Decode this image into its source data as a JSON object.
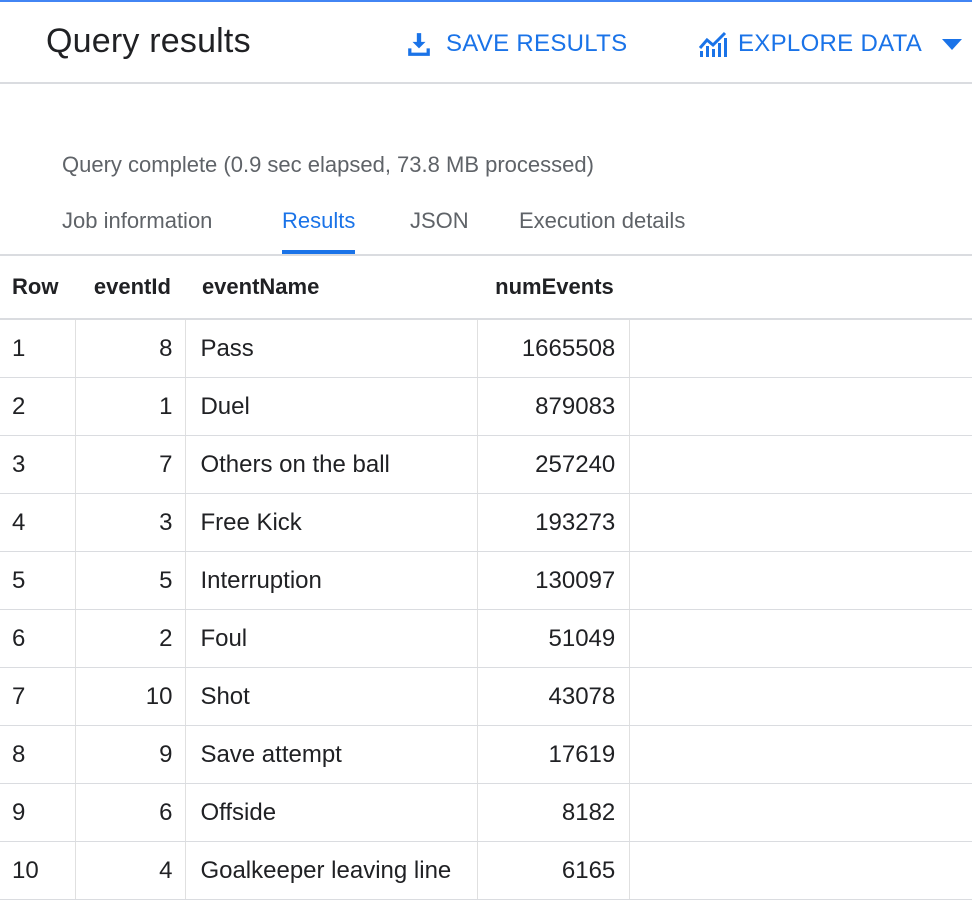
{
  "header": {
    "title": "Query results",
    "save_label": "SAVE RESULTS",
    "explore_label": "EXPLORE DATA",
    "accent": "#1a73e8"
  },
  "status": "Query complete (0.9 sec elapsed, 73.8 MB processed)",
  "tabs": [
    {
      "label": "Job information",
      "active": false
    },
    {
      "label": "Results",
      "active": true
    },
    {
      "label": "JSON",
      "active": false
    },
    {
      "label": "Execution details",
      "active": false
    }
  ],
  "table": {
    "columns": [
      "Row",
      "eventId",
      "eventName",
      "numEvents"
    ],
    "rows": [
      {
        "row": "1",
        "eventId": "8",
        "eventName": "Pass",
        "numEvents": "1665508"
      },
      {
        "row": "2",
        "eventId": "1",
        "eventName": "Duel",
        "numEvents": "879083"
      },
      {
        "row": "3",
        "eventId": "7",
        "eventName": "Others on the ball",
        "numEvents": "257240"
      },
      {
        "row": "4",
        "eventId": "3",
        "eventName": "Free Kick",
        "numEvents": "193273"
      },
      {
        "row": "5",
        "eventId": "5",
        "eventName": "Interruption",
        "numEvents": "130097"
      },
      {
        "row": "6",
        "eventId": "2",
        "eventName": "Foul",
        "numEvents": "51049"
      },
      {
        "row": "7",
        "eventId": "10",
        "eventName": "Shot",
        "numEvents": "43078"
      },
      {
        "row": "8",
        "eventId": "9",
        "eventName": "Save attempt",
        "numEvents": "17619"
      },
      {
        "row": "9",
        "eventId": "6",
        "eventName": "Offside",
        "numEvents": "8182"
      },
      {
        "row": "10",
        "eventId": "4",
        "eventName": "Goalkeeper leaving line",
        "numEvents": "6165"
      }
    ]
  },
  "icons": {
    "save": "download-icon",
    "explore": "chart-line-icon",
    "dropdown": "caret-down-icon"
  }
}
